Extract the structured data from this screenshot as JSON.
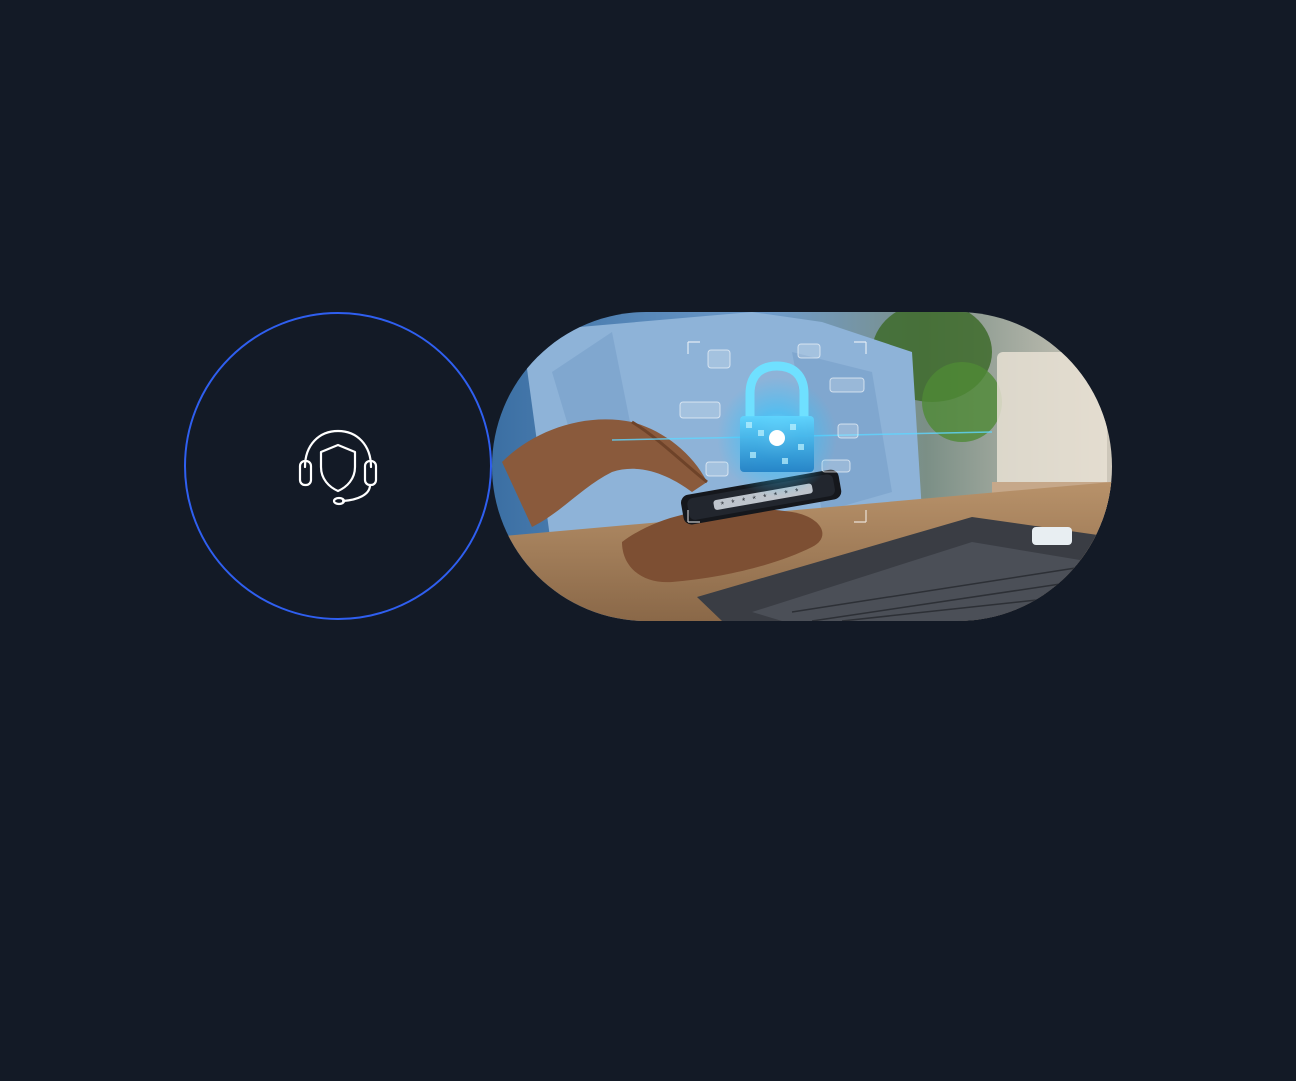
{
  "background_color": "#131a26",
  "accent_color": "#2f5ff0",
  "icon": {
    "name": "headset-shield-icon",
    "stroke_color": "#ffffff"
  },
  "photo": {
    "subject": "hands-holding-smartphone-with-padlock-hologram",
    "accent_glow": "#2fc4ff"
  }
}
